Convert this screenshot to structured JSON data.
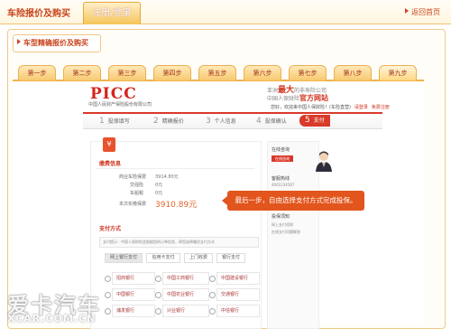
{
  "header": {
    "title": "车险报价及购买",
    "tab_label": "注册/登录",
    "home_link": "返回首页"
  },
  "subtitle": "车型精确报价及购买",
  "steps": [
    "第一步",
    "第二步",
    "第三步",
    "第四步",
    "第五步",
    "第六步",
    "第七步",
    "第八步",
    "第九步"
  ],
  "brand": {
    "logo": "PICC",
    "company": "中国人民财产保险股份有限公司",
    "slogan_prefix": "亚洲",
    "slogan_big": "最大",
    "slogan_suffix": "的非寿险公司",
    "slogan2_prefix": "中国人保财险",
    "slogan2_big": "官方网站",
    "welcome": "您好，欢迎来中国人保财险！(车险直营)",
    "welcome_link1": "请登录",
    "welcome_link2": "免费注册"
  },
  "progress": {
    "items": [
      {
        "n": "1",
        "label": "投保填写"
      },
      {
        "n": "2",
        "label": "精确报价"
      },
      {
        "n": "3",
        "label": "个人信息"
      },
      {
        "n": "4",
        "label": "投保确认"
      },
      {
        "n": "5",
        "label": "支付"
      }
    ]
  },
  "order": {
    "section_title": "缴费信息",
    "rows": [
      {
        "label": "商业车险保费",
        "value": "3914.80元"
      },
      {
        "label": "交强险",
        "value": "0元"
      },
      {
        "label": "车船税",
        "value": "0元"
      },
      {
        "label": "本次实缴保费",
        "value": "3910.89元"
      }
    ]
  },
  "payment": {
    "section_title": "支付方式",
    "note": "支付提示：中国人保财险会根据您的订单信息，帮您选择最优支付方式",
    "tabs": [
      "网上银行支付",
      "信用卡支付",
      "上门收费",
      "银行支付"
    ],
    "banks": [
      "招商银行",
      "中国工商银行",
      "中国建设银行",
      "中国银行",
      "中国农业银行",
      "交通银行",
      "浦发银行",
      "兴业银行",
      "中信银行"
    ]
  },
  "sidebar": {
    "title1": "在线咨询",
    "btn": "在线咨询",
    "title2": "客服热线",
    "hotline": "4001234567",
    "title3": "投保须知",
    "items": [
      "网上支付须知",
      "在线支付问题解答"
    ]
  },
  "tooltip": "最后一步，自由选择支付方式完成投保。",
  "watermark": {
    "main": "爱卡汽车",
    "url": "XCAR.COM.CN"
  }
}
